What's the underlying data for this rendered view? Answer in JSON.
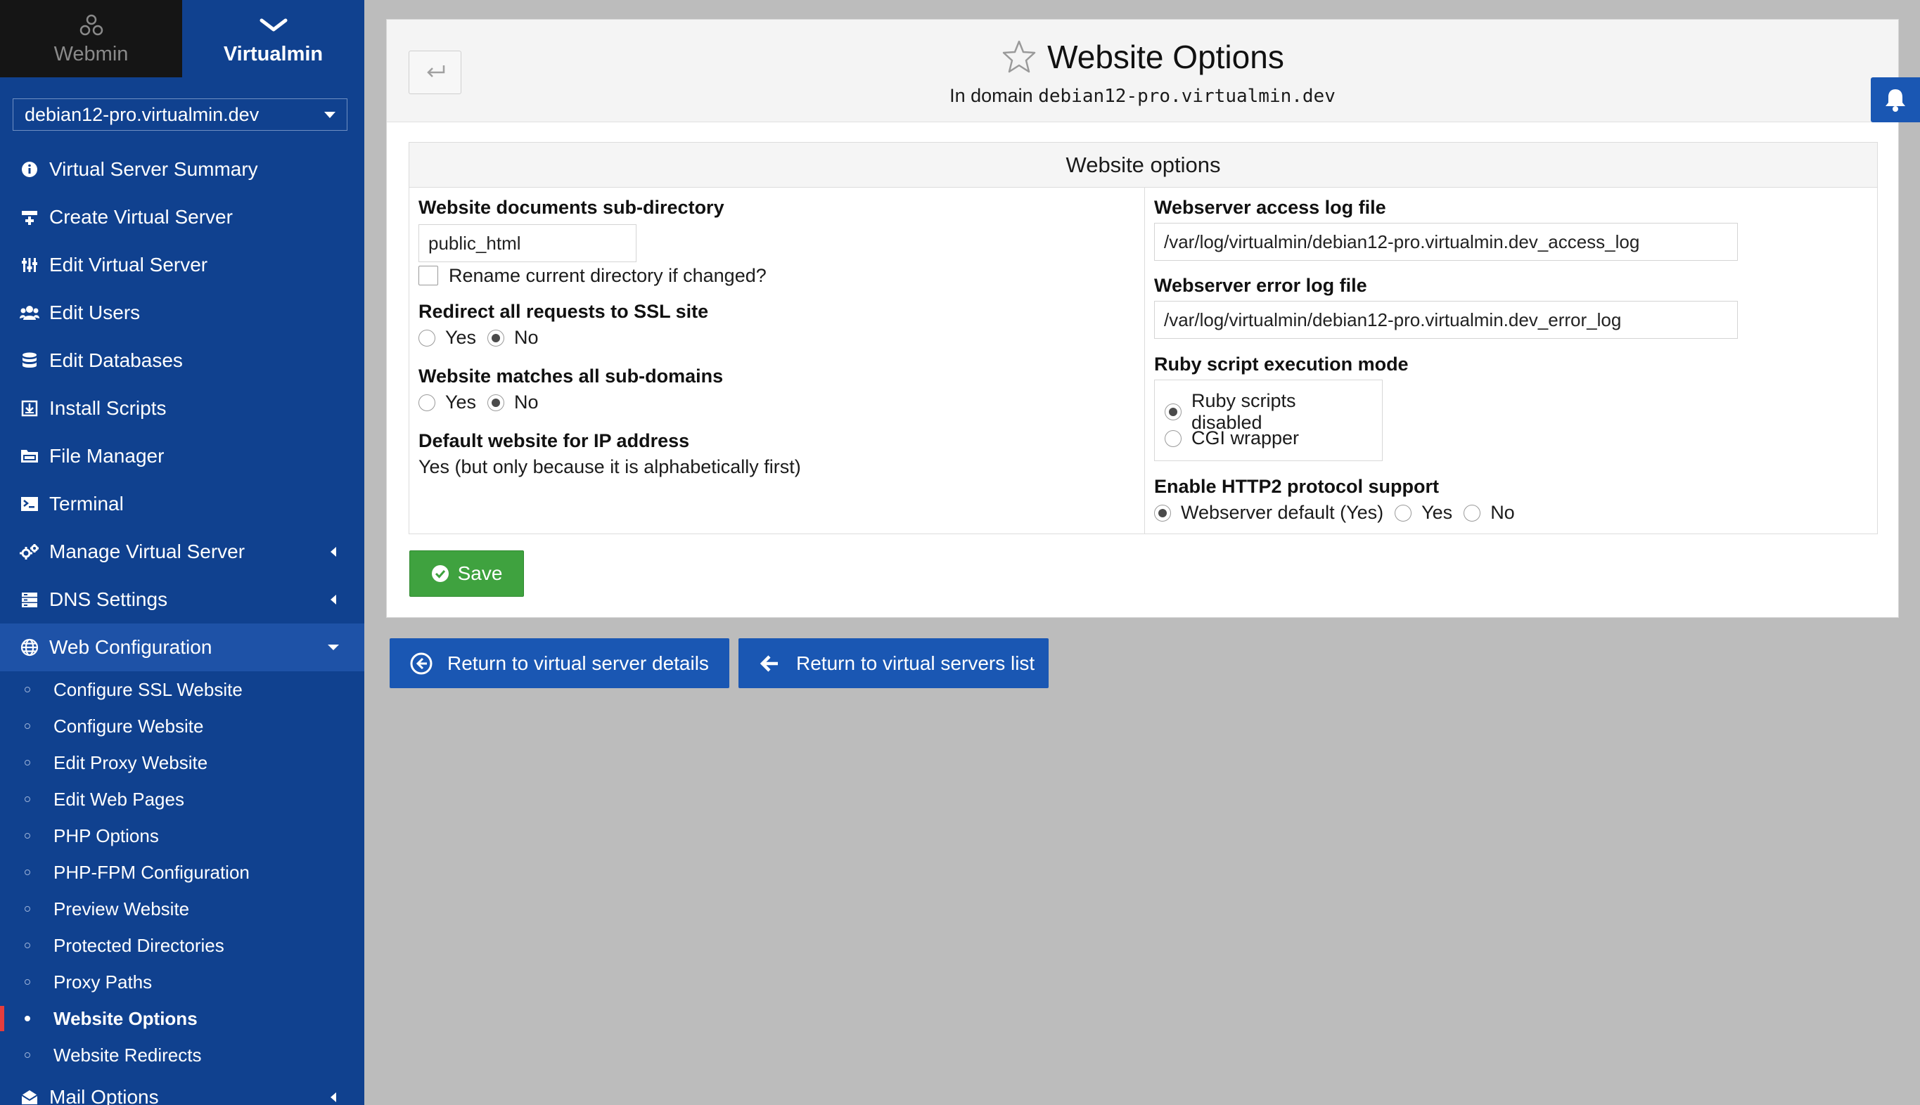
{
  "switcher": {
    "webmin_label": "Webmin",
    "virtualmin_label": "Virtualmin"
  },
  "domain_selector": {
    "value": "debian12-pro.virtualmin.dev"
  },
  "menu": {
    "items": [
      {
        "label": "Virtual Server Summary",
        "icon": "info-icon"
      },
      {
        "label": "Create Virtual Server",
        "icon": "create-server-icon"
      },
      {
        "label": "Edit Virtual Server",
        "icon": "sliders-icon"
      },
      {
        "label": "Edit Users",
        "icon": "users-icon"
      },
      {
        "label": "Edit Databases",
        "icon": "database-icon"
      },
      {
        "label": "Install Scripts",
        "icon": "download-box-icon"
      },
      {
        "label": "File Manager",
        "icon": "folder-icon"
      },
      {
        "label": "Terminal",
        "icon": "terminal-icon"
      },
      {
        "label": "Manage Virtual Server",
        "icon": "cogs-icon"
      },
      {
        "label": "DNS Settings",
        "icon": "server-icon"
      },
      {
        "label": "Web Configuration",
        "icon": "globe-icon"
      }
    ],
    "web_sub_items": [
      "Configure SSL Website",
      "Configure Website",
      "Edit Proxy Website",
      "Edit Web Pages",
      "PHP Options",
      "PHP-FPM Configuration",
      "Preview Website",
      "Protected Directories",
      "Proxy Paths",
      "Website Options",
      "Website Redirects"
    ],
    "current_sub_item": "Website Options",
    "mail_options_label": "Mail Options"
  },
  "header": {
    "title": "Website Options",
    "subtitle_prefix": "In domain",
    "subtitle_domain": "debian12-pro.virtualmin.dev",
    "back_icon": "return-arrow-icon"
  },
  "options": {
    "section_title": "Website options",
    "doc_subdir": {
      "label": "Website documents sub-directory",
      "value": "public_html",
      "rename_label": "Rename current directory if changed?",
      "rename_checked": false
    },
    "redirect_ssl": {
      "label": "Redirect all requests to SSL site",
      "options": [
        "Yes",
        "No"
      ],
      "selected": "No"
    },
    "match_subdomains": {
      "label": "Website matches all sub-domains",
      "options": [
        "Yes",
        "No"
      ],
      "selected": "No"
    },
    "default_website": {
      "label": "Default website for IP address",
      "value": "Yes (but only because it is alphabetically first)"
    },
    "access_log": {
      "label": "Webserver access log file",
      "value": "/var/log/virtualmin/debian12-pro.virtualmin.dev_access_log"
    },
    "error_log": {
      "label": "Webserver error log file",
      "value": "/var/log/virtualmin/debian12-pro.virtualmin.dev_error_log"
    },
    "ruby_mode": {
      "label": "Ruby script execution mode",
      "options": [
        "Ruby scripts disabled",
        "CGI wrapper"
      ],
      "selected": "Ruby scripts disabled"
    },
    "http2": {
      "label": "Enable HTTP2 protocol support",
      "options": [
        "Webserver default (Yes)",
        "Yes",
        "No"
      ],
      "selected": "Webserver default (Yes)"
    }
  },
  "buttons": {
    "save": "Save",
    "return_details": "Return to virtual server details",
    "return_list": "Return to virtual servers list"
  },
  "colors": {
    "sidebar": "#10418f",
    "active_sub": "#e43d3d",
    "save_green": "#3fa23f",
    "action_blue": "#1a57b3"
  }
}
